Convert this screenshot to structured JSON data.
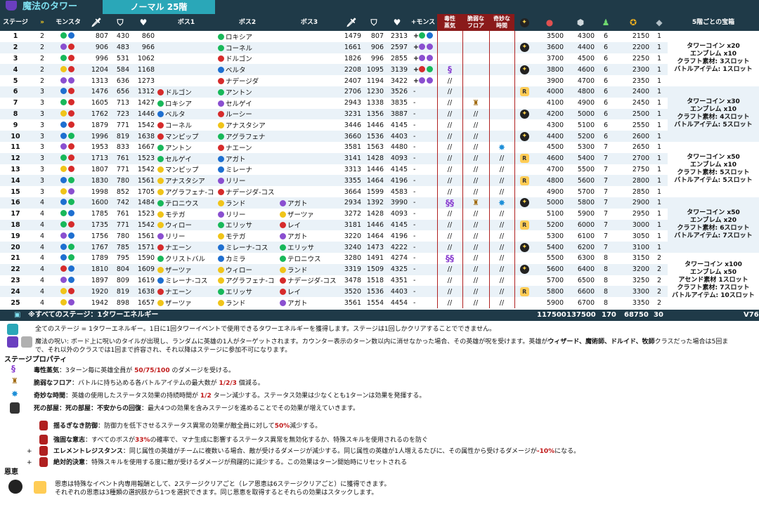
{
  "title": "魔法のタワー",
  "mode": "ノーマル 25階",
  "headers": {
    "stage": "ステージ",
    "monster": "モンスタ",
    "boss1": "ボス1",
    "boss2": "ボス2",
    "boss3": "ボス3",
    "plus_monster": "+モンスタ",
    "toxic": "毒性\n蒸気",
    "fragile": "脆弱な\nフロア",
    "strange": "奇妙な\n時間",
    "reward": "5階ごとの宝箱"
  },
  "rows": [
    {
      "stage": "1",
      "speed": "2",
      "mdots": [
        "g",
        "b"
      ],
      "atk": "807",
      "def": "430",
      "hp": "860",
      "b1": "",
      "b1c": "",
      "b2": "ロキシア",
      "b2c": "g",
      "b3": "",
      "b3c": "",
      "atk2": "1479",
      "def2": "807",
      "hp2": "2313",
      "plus": [
        "g",
        "b"
      ],
      "tox": "",
      "frag": "",
      "str": "",
      "bless": "",
      "c1": "3500",
      "c2": "4300",
      "c3": "6",
      "c4": "2150",
      "c5": "1"
    },
    {
      "stage": "2",
      "speed": "2",
      "mdots": [
        "p",
        "r"
      ],
      "atk": "906",
      "def": "483",
      "hp": "966",
      "b1": "",
      "b1c": "",
      "b2": "コーネル",
      "b2c": "g",
      "b3": "",
      "b3c": "",
      "atk2": "1661",
      "def2": "906",
      "hp2": "2597",
      "plus": [
        "p",
        "p"
      ],
      "tox": "",
      "frag": "",
      "str": "",
      "bless": "star",
      "c1": "3600",
      "c2": "4400",
      "c3": "6",
      "c4": "2200",
      "c5": "1"
    },
    {
      "stage": "3",
      "speed": "2",
      "mdots": [
        "g",
        "r"
      ],
      "atk": "996",
      "def": "531",
      "hp": "1062",
      "b1": "",
      "b1c": "",
      "b2": "ドルゴン",
      "b2c": "r",
      "b3": "",
      "b3c": "",
      "atk2": "1826",
      "def2": "996",
      "hp2": "2855",
      "plus": [
        "p",
        "p"
      ],
      "tox": "",
      "frag": "",
      "str": "",
      "bless": "",
      "c1": "3700",
      "c2": "4500",
      "c3": "6",
      "c4": "2250",
      "c5": "1"
    },
    {
      "stage": "4",
      "speed": "2",
      "mdots": [
        "y",
        "r"
      ],
      "atk": "1204",
      "def": "584",
      "hp": "1168",
      "b1": "",
      "b1c": "",
      "b2": "ベルタ",
      "b2c": "b",
      "b3": "",
      "b3c": "",
      "atk2": "2208",
      "def2": "1095",
      "hp2": "3139",
      "plus": [
        "r",
        "g"
      ],
      "tox": "sw",
      "frag": "",
      "str": "",
      "bless": "star",
      "c1": "3800",
      "c2": "4600",
      "c3": "6",
      "c4": "2300",
      "c5": "1"
    },
    {
      "stage": "5",
      "speed": "2",
      "mdots": [
        "p",
        "p"
      ],
      "atk": "1313",
      "def": "636",
      "hp": "1273",
      "b1": "",
      "b1c": "",
      "b2": "ナデージダ",
      "b2c": "r",
      "b3": "",
      "b3c": "",
      "atk2": "2407",
      "def2": "1194",
      "hp2": "3422",
      "plus": [
        "p",
        "p"
      ],
      "tox": "//",
      "frag": "",
      "str": "",
      "bless": "",
      "c1": "3900",
      "c2": "4700",
      "c3": "6",
      "c4": "2350",
      "c5": "1"
    },
    {
      "stage": "6",
      "speed": "3",
      "mdots": [
        "b",
        "r"
      ],
      "atk": "1476",
      "def": "656",
      "hp": "1312",
      "b1": "ドルゴン",
      "b1c": "r",
      "b2": "アントン",
      "b2c": "g",
      "b3": "",
      "b3c": "",
      "atk2": "2706",
      "def2": "1230",
      "hp2": "3526",
      "plus": [],
      "tox": "//",
      "frag": "",
      "str": "",
      "bless": "tok",
      "c1": "4000",
      "c2": "4800",
      "c3": "6",
      "c4": "2400",
      "c5": "1"
    },
    {
      "stage": "7",
      "speed": "3",
      "mdots": [
        "g",
        "r"
      ],
      "atk": "1605",
      "def": "713",
      "hp": "1427",
      "b1": "ロキシア",
      "b1c": "g",
      "b2": "セルゲイ",
      "b2c": "p",
      "b3": "",
      "b3c": "",
      "atk2": "2943",
      "def2": "1338",
      "hp2": "3835",
      "plus": [],
      "tox": "//",
      "frag": "bag",
      "str": "",
      "bless": "",
      "c1": "4100",
      "c2": "4900",
      "c3": "6",
      "c4": "2450",
      "c5": "1"
    },
    {
      "stage": "8",
      "speed": "3",
      "mdots": [
        "y",
        "r"
      ],
      "atk": "1762",
      "def": "723",
      "hp": "1446",
      "b1": "ベルタ",
      "b1c": "b",
      "b2": "ルーシー",
      "b2c": "r",
      "b3": "",
      "b3c": "",
      "atk2": "3231",
      "def2": "1356",
      "hp2": "3887",
      "plus": [],
      "tox": "//",
      "frag": "//",
      "str": "",
      "bless": "star",
      "c1": "4200",
      "c2": "5000",
      "c3": "6",
      "c4": "2500",
      "c5": "1"
    },
    {
      "stage": "9",
      "speed": "3",
      "mdots": [
        "b",
        "r"
      ],
      "atk": "1879",
      "def": "771",
      "hp": "1542",
      "b1": "コーネル",
      "b1c": "r",
      "b2": "アナスタシア",
      "b2c": "y",
      "b3": "",
      "b3c": "",
      "atk2": "3446",
      "def2": "1446",
      "hp2": "4145",
      "plus": [],
      "tox": "//",
      "frag": "//",
      "str": "",
      "bless": "",
      "c1": "4300",
      "c2": "5100",
      "c3": "6",
      "c4": "2550",
      "c5": "1"
    },
    {
      "stage": "10",
      "speed": "3",
      "mdots": [
        "b",
        "g"
      ],
      "atk": "1996",
      "def": "819",
      "hp": "1638",
      "b1": "マンピップ",
      "b1c": "r",
      "b2": "アグラフェナ",
      "b2c": "g",
      "b3": "",
      "b3c": "",
      "atk2": "3660",
      "def2": "1536",
      "hp2": "4403",
      "plus": [],
      "tox": "//",
      "frag": "//",
      "str": "",
      "bless": "star",
      "c1": "4400",
      "c2": "5200",
      "c3": "6",
      "c4": "2600",
      "c5": "1"
    },
    {
      "stage": "11",
      "speed": "3",
      "mdots": [
        "p",
        "r"
      ],
      "atk": "1953",
      "def": "833",
      "hp": "1667",
      "b1": "アントン",
      "b1c": "g",
      "b2": "ナエーン",
      "b2c": "r",
      "b3": "",
      "b3c": "",
      "atk2": "3581",
      "def2": "1563",
      "hp2": "4480",
      "plus": [],
      "tox": "//",
      "frag": "//",
      "str": "clk",
      "bless": "",
      "c1": "4500",
      "c2": "5300",
      "c3": "7",
      "c4": "2650",
      "c5": "1"
    },
    {
      "stage": "12",
      "speed": "3",
      "mdots": [
        "g",
        "r"
      ],
      "atk": "1713",
      "def": "761",
      "hp": "1523",
      "b1": "セルゲイ",
      "b1c": "g",
      "b2": "アガト",
      "b2c": "b",
      "b3": "",
      "b3c": "",
      "atk2": "3141",
      "def2": "1428",
      "hp2": "4093",
      "plus": [],
      "tox": "//",
      "frag": "//",
      "str": "//",
      "bless": "tok",
      "c1": "4600",
      "c2": "5400",
      "c3": "7",
      "c4": "2700",
      "c5": "1"
    },
    {
      "stage": "13",
      "speed": "3",
      "mdots": [
        "y",
        "r"
      ],
      "atk": "1807",
      "def": "771",
      "hp": "1542",
      "b1": "マンピップ",
      "b1c": "y",
      "b2": "ミレーナ",
      "b2c": "b",
      "b3": "",
      "b3c": "",
      "atk2": "3313",
      "def2": "1446",
      "hp2": "4145",
      "plus": [],
      "tox": "//",
      "frag": "//",
      "str": "//",
      "bless": "",
      "c1": "4700",
      "c2": "5500",
      "c3": "7",
      "c4": "2750",
      "c5": "1"
    },
    {
      "stage": "14",
      "speed": "3",
      "mdots": [
        "b",
        "g"
      ],
      "atk": "1830",
      "def": "780",
      "hp": "1561",
      "b1": "アナスタシア",
      "b1c": "y",
      "b2": "リリー",
      "b2c": "p",
      "b3": "",
      "b3c": "",
      "atk2": "3355",
      "def2": "1464",
      "hp2": "4196",
      "plus": [],
      "tox": "//",
      "frag": "//",
      "str": "//",
      "bless": "tok",
      "c1": "4800",
      "c2": "5600",
      "c3": "7",
      "c4": "2800",
      "c5": "1"
    },
    {
      "stage": "15",
      "speed": "3",
      "mdots": [
        "y",
        "p"
      ],
      "atk": "1998",
      "def": "852",
      "hp": "1705",
      "b1": "アグラフェナ-コ",
      "b1c": "y",
      "b2": "ナデージダ-コス",
      "b2c": "r",
      "b3": "",
      "b3c": "",
      "atk2": "3664",
      "def2": "1599",
      "hp2": "4583",
      "plus": [],
      "tox": "//",
      "frag": "//",
      "str": "//",
      "bless": "",
      "c1": "4900",
      "c2": "5700",
      "c3": "7",
      "c4": "2850",
      "c5": "1"
    },
    {
      "stage": "16",
      "speed": "4",
      "mdots": [
        "b",
        "g"
      ],
      "atk": "1600",
      "def": "742",
      "hp": "1484",
      "b1": "テロニウス",
      "b1c": "g",
      "b2": "ランド",
      "b2c": "y",
      "b3": "アガト",
      "b3c": "p",
      "atk2": "2934",
      "def2": "1392",
      "hp2": "3990",
      "plus": [],
      "tox": "sw2",
      "frag": "bag",
      "str": "clk",
      "bless": "star",
      "c1": "5000",
      "c2": "5800",
      "c3": "7",
      "c4": "2900",
      "c5": "1"
    },
    {
      "stage": "17",
      "speed": "4",
      "mdots": [
        "g",
        "b"
      ],
      "atk": "1785",
      "def": "761",
      "hp": "1523",
      "b1": "モテガ",
      "b1c": "y",
      "b2": "リリー",
      "b2c": "p",
      "b3": "ザーツァ",
      "b3c": "y",
      "atk2": "3272",
      "def2": "1428",
      "hp2": "4093",
      "plus": [],
      "tox": "//",
      "frag": "//",
      "str": "//",
      "bless": "",
      "c1": "5100",
      "c2": "5900",
      "c3": "7",
      "c4": "2950",
      "c5": "1"
    },
    {
      "stage": "18",
      "speed": "4",
      "mdots": [
        "g",
        "r"
      ],
      "atk": "1735",
      "def": "771",
      "hp": "1542",
      "b1": "ウィロー",
      "b1c": "y",
      "b2": "エリッサ",
      "b2c": "g",
      "b3": "レイ",
      "b3c": "r",
      "atk2": "3181",
      "def2": "1446",
      "hp2": "4145",
      "plus": [],
      "tox": "//",
      "frag": "//",
      "str": "//",
      "bless": "tok",
      "c1": "5200",
      "c2": "6000",
      "c3": "7",
      "c4": "3000",
      "c5": "1"
    },
    {
      "stage": "19",
      "speed": "4",
      "mdots": [
        "p",
        "b"
      ],
      "atk": "1756",
      "def": "780",
      "hp": "1561",
      "b1": "リリー",
      "b1c": "p",
      "b2": "モテガ",
      "b2c": "y",
      "b3": "アガト",
      "b3c": "p",
      "atk2": "3220",
      "def2": "1464",
      "hp2": "4196",
      "plus": [],
      "tox": "//",
      "frag": "//",
      "str": "//",
      "bless": "",
      "c1": "5300",
      "c2": "6100",
      "c3": "7",
      "c4": "3050",
      "c5": "1"
    },
    {
      "stage": "20",
      "speed": "4",
      "mdots": [
        "b",
        "g"
      ],
      "atk": "1767",
      "def": "785",
      "hp": "1571",
      "b1": "ナエーン",
      "b1c": "r",
      "b2": "ミレーナ-コス",
      "b2c": "b",
      "b3": "エリッサ",
      "b3c": "g",
      "atk2": "3240",
      "def2": "1473",
      "hp2": "4222",
      "plus": [],
      "tox": "//",
      "frag": "//",
      "str": "//",
      "bless": "star",
      "c1": "5400",
      "c2": "6200",
      "c3": "7",
      "c4": "3100",
      "c5": "1"
    },
    {
      "stage": "21",
      "speed": "4",
      "mdots": [
        "b",
        "g"
      ],
      "atk": "1789",
      "def": "795",
      "hp": "1590",
      "b1": "クリストバル",
      "b1c": "g",
      "b2": "カミラ",
      "b2c": "b",
      "b3": "テロニウス",
      "b3c": "g",
      "atk2": "3280",
      "def2": "1491",
      "hp2": "4274",
      "plus": [],
      "tox": "sw2",
      "frag": "//",
      "str": "//",
      "bless": "",
      "c1": "5500",
      "c2": "6300",
      "c3": "8",
      "c4": "3150",
      "c5": "2"
    },
    {
      "stage": "22",
      "speed": "4",
      "mdots": [
        "r",
        "b"
      ],
      "atk": "1810",
      "def": "804",
      "hp": "1609",
      "b1": "ザーツァ",
      "b1c": "y",
      "b2": "ウィロー",
      "b2c": "y",
      "b3": "ランド",
      "b3c": "y",
      "atk2": "3319",
      "def2": "1509",
      "hp2": "4325",
      "plus": [],
      "tox": "//",
      "frag": "//",
      "str": "//",
      "bless": "star",
      "c1": "5600",
      "c2": "6400",
      "c3": "8",
      "c4": "3200",
      "c5": "2"
    },
    {
      "stage": "23",
      "speed": "4",
      "mdots": [
        "p",
        "b"
      ],
      "atk": "1897",
      "def": "809",
      "hp": "1619",
      "b1": "ミレーナ-コス",
      "b1c": "b",
      "b2": "アグラフェナ-コ",
      "b2c": "y",
      "b3": "ナデージダ-コス",
      "b3c": "r",
      "atk2": "3478",
      "def2": "1518",
      "hp2": "4351",
      "plus": [],
      "tox": "//",
      "frag": "//",
      "str": "//",
      "bless": "",
      "c1": "5700",
      "c2": "6500",
      "c3": "8",
      "c4": "3250",
      "c5": "2"
    },
    {
      "stage": "24",
      "speed": "4",
      "mdots": [
        "y",
        "r"
      ],
      "atk": "1920",
      "def": "819",
      "hp": "1638",
      "b1": "ナエーン",
      "b1c": "r",
      "b2": "エリッサ",
      "b2c": "g",
      "b3": "レイ",
      "b3c": "r",
      "atk2": "3520",
      "def2": "1536",
      "hp2": "4403",
      "plus": [],
      "tox": "//",
      "frag": "//",
      "str": "//",
      "bless": "tok",
      "c1": "5800",
      "c2": "6600",
      "c3": "8",
      "c4": "3300",
      "c5": "2"
    },
    {
      "stage": "25",
      "speed": "4",
      "mdots": [
        "y",
        "p"
      ],
      "atk": "1942",
      "def": "898",
      "hp": "1657",
      "b1": "ザーツァ",
      "b1c": "y",
      "b2": "ランド",
      "b2c": "y",
      "b3": "アガト",
      "b3c": "p",
      "atk2": "3561",
      "def2": "1554",
      "hp2": "4454",
      "plus": [],
      "tox": "//",
      "frag": "//",
      "str": "//",
      "bless": "",
      "c1": "5900",
      "c2": "6700",
      "c3": "8",
      "c4": "3350",
      "c5": "2"
    }
  ],
  "rewards": [
    "タワーコイン x20\nエンブレム x10\nクラフト素材: 3スロット\nバトルアイテム: 1スロット",
    "タワーコイン x30\nエンブレム x10\nクラフト素材: 4スロット\nバトルアイテム: 5スロット",
    "タワーコイン x50\nエンブレム x10\nクラフト素材: 5スロット\nバトルアイテム: 5スロット",
    "タワーコイン x50\nエンブレム x20\nクラフト素材: 6スロット\nバトルアイテム: 7スロット",
    "タワーコイン x100\nエンブレム x50\nアセンド素材 1スロット\nクラフト素材: 7スロット\nバトルアイテム: 10スロット"
  ],
  "totals": {
    "label": "※すべてのステージ：1タワーエネルギー",
    "t1": "117500",
    "t2": "137500",
    "t3": "170",
    "t4": "68750",
    "t5": "30",
    "version": "V76"
  },
  "notes": {
    "energy": "全てのステージ = 1タワーエネルギー。1日に1回タワーイベントで使用できるタワーエネルギーを獲得します。ステージは1回しかクリアすることでできません。",
    "curse1": "魔法の呪い: ボード上に呪いのタイルが出現し、ランダムに英雄の1人がターゲットされます。カウンター表示のターン数以内に消せなかった場合、その英雄が呪を受けます。英雄が",
    "curse_classes": "ウィザード、魔術師、ドルイド、牧師",
    "curse2": "クラスだった場合は5回ま",
    "curse3": "で、それ以外のクラスでは1回まで許容され、それ以降はステージに参加不可になります。",
    "props_title": "ステージプロパティ",
    "toxic_name": "毒性蒸気",
    "toxic_desc": "：3ターン毎に英雄全員が",
    "toxic_val": "50/75/100",
    "toxic_end": "のダメージを受ける。",
    "fragile_name": "脆弱なフロア",
    "fragile_desc": "：バトルに持ち込める各バトルアイテムの最大数が",
    "fragile_val": "1/2/3",
    "fragile_end": "個減る。",
    "strange_name": "奇妙な時間",
    "strange_desc": "：英雄の使用したステータス効果の持続時間が",
    "strange_val": "1/2",
    "strange_end": "ターン減少する。ステータス効果は少なくとも1ターンは効果を発揮する。",
    "death_name": "死の部屋：死の部屋：不安からの回復",
    "death_desc": "：最大4つの効果を含みステージを進めることでその効果が増えていきます。",
    "d1_name": "揺るぎなき防御",
    "d1_desc": "：防御力を低下させるステータス異常の効果が敵全員に対して",
    "d1_val": "50%",
    "d1_end": "減少する。",
    "d2_name": "強固な意志",
    "d2_desc": "：すべてのボスが",
    "d2_val": "33%",
    "d2_end": "の確率で、マナ生成に影響するステータス異常を無効化するか、特殊スキルを使用されるのを防ぐ",
    "d3_name": "エレメントレジスタンス",
    "d3_desc": "：同じ属性の英雄がチームに複数いる場合、敵が受けるダメージが減少する。同じ属性の英雄が1人増えるたびに、その属性から受けるダメージが",
    "d3_val": "-10%",
    "d3_end": "になる。",
    "d4_name": "絶対的決意",
    "d4_desc": "：特殊スキルを使用する度に敵が受けるダメージが飛躍的に減少する。この効果はターン開始時にリセットされる",
    "blessing_title": "恩恵",
    "bless1": "恩恵は特殊なイベント内専用報酬として、2ステージクリアごと（レア恩恵は6ステージクリアごと）に獲得できます。",
    "bless2": "それぞれの恩恵は3種類の選択肢から1つを選択できます。同じ恩恵を取得するとそれらの効果はスタックします。",
    "plus": "+"
  },
  "colors": {
    "header": "#1f3a48",
    "accent": "#2aa7b8",
    "red": "#c01818"
  }
}
